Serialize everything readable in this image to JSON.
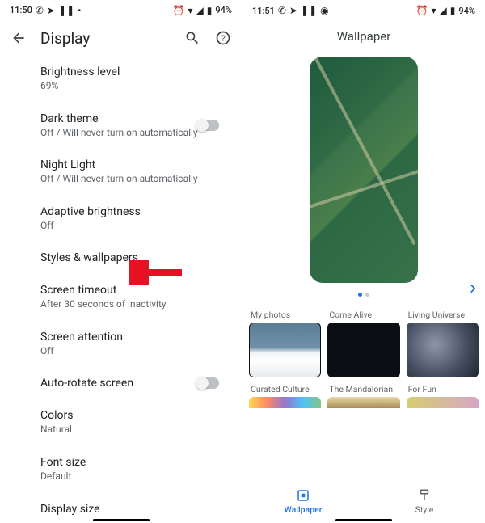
{
  "status_left": {
    "time": "11:50",
    "icons": [
      "whatsapp-icon",
      "send-icon",
      "pause-icon",
      "more-icon"
    ],
    "right_icons": [
      "alarm-icon",
      "wifi-icon",
      "signal-icon",
      "battery-icon"
    ],
    "battery": "94%"
  },
  "status_right": {
    "time": "11:51",
    "icons": [
      "whatsapp-icon",
      "send-icon",
      "pause-icon",
      "app-icon"
    ],
    "right_icons": [
      "alarm-icon",
      "wifi-icon",
      "signal-icon",
      "battery-icon"
    ],
    "battery": "94%"
  },
  "left_pane": {
    "title": "Display",
    "settings": [
      {
        "label": "Brightness level",
        "sub": "69%",
        "toggle": false
      },
      {
        "label": "Dark theme",
        "sub": "Off / Will never turn on automatically",
        "toggle": true
      },
      {
        "label": "Night Light",
        "sub": "Off / Will never turn on automatically",
        "toggle": false
      },
      {
        "label": "Adaptive brightness",
        "sub": "Off",
        "toggle": false
      },
      {
        "label": "Styles & wallpapers",
        "sub": "",
        "toggle": false
      },
      {
        "label": "Screen timeout",
        "sub": "After 30 seconds of inactivity",
        "toggle": false
      },
      {
        "label": "Screen attention",
        "sub": "Off",
        "toggle": false
      },
      {
        "label": "Auto-rotate screen",
        "sub": "",
        "toggle": true
      },
      {
        "label": "Colors",
        "sub": "Natural",
        "toggle": false
      },
      {
        "label": "Font size",
        "sub": "Default",
        "toggle": false
      },
      {
        "label": "Display size",
        "sub": "",
        "toggle": false
      }
    ]
  },
  "right_pane": {
    "title": "Wallpaper",
    "categories": [
      {
        "label": "My photos",
        "style": "photos"
      },
      {
        "label": "Come Alive",
        "style": "alive"
      },
      {
        "label": "Living Universe",
        "style": "living"
      },
      {
        "label": "Curated Culture",
        "style": "curated"
      },
      {
        "label": "The Mandalorian",
        "style": "mando"
      },
      {
        "label": "For Fun",
        "style": "forfun"
      }
    ],
    "nav": [
      {
        "label": "Wallpaper",
        "active": true
      },
      {
        "label": "Style",
        "active": false
      }
    ]
  },
  "annotations": {
    "arrow_color": "#e81123"
  }
}
